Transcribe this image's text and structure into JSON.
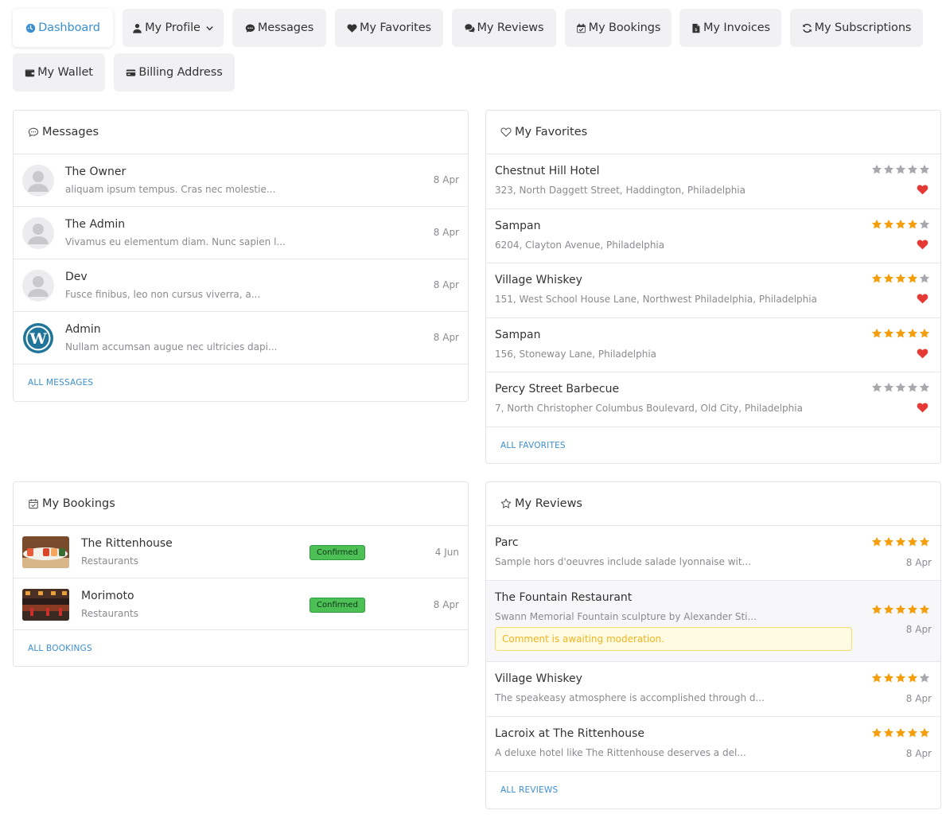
{
  "nav": {
    "dashboard": "Dashboard",
    "my_profile": "My Profile",
    "messages": "Messages",
    "my_favorites": "My Favorites",
    "my_reviews": "My Reviews",
    "my_bookings": "My Bookings",
    "my_invoices": "My Invoices",
    "my_subscriptions": "My Subscriptions",
    "my_wallet": "My Wallet",
    "billing_address": "Billing Address"
  },
  "messages": {
    "title": "Messages",
    "items": [
      {
        "name": "The Owner",
        "text": "aliquam ipsum tempus. Cras nec molestie...",
        "date": "8 Apr",
        "avatar": "default-avatar"
      },
      {
        "name": "The Admin",
        "text": "Vivamus eu elementum diam. Nunc sapien l...",
        "date": "8 Apr",
        "avatar": "default-avatar"
      },
      {
        "name": "Dev",
        "text": "Fusce finibus, leo non cursus viverra, a...",
        "date": "8 Apr",
        "avatar": "default-avatar"
      },
      {
        "name": "Admin",
        "text": "Nullam accumsan augue nec ultricies dapi...",
        "date": "8 Apr",
        "avatar": "wordpress-avatar"
      }
    ],
    "footer": "ALL MESSAGES"
  },
  "favorites": {
    "title": "My Favorites",
    "items": [
      {
        "name": "Chestnut Hill Hotel",
        "address": "323, North Daggett Street, Haddington, Philadelphia",
        "rating": 0
      },
      {
        "name": "Sampan",
        "address": "6204, Clayton Avenue, Philadelphia",
        "rating": 4
      },
      {
        "name": "Village Whiskey",
        "address": "151, West School House Lane, Northwest Philadelphia, Philadelphia",
        "rating": 4
      },
      {
        "name": "Sampan",
        "address": "156, Stoneway Lane, Philadelphia",
        "rating": 5
      },
      {
        "name": "Percy Street Barbecue",
        "address": "7, North Christopher Columbus Boulevard, Old City, Philadelphia",
        "rating": 0
      }
    ],
    "footer": "ALL FAVORITES"
  },
  "bookings": {
    "title": "My Bookings",
    "items": [
      {
        "name": "The Rittenhouse",
        "category": "Restaurants",
        "status": "Confirmed",
        "date": "4 Jun",
        "thumb": "sushi-photo"
      },
      {
        "name": "Morimoto",
        "category": "Restaurants",
        "status": "Confirmed",
        "date": "8 Apr",
        "thumb": "restaurant-interior-photo"
      }
    ],
    "footer": "ALL BOOKINGS"
  },
  "reviews": {
    "title": "My Reviews",
    "items": [
      {
        "name": "Parc",
        "text": "Sample hors d'oeuvres include salade lyonnaise wit...",
        "date": "8 Apr",
        "rating": 5
      },
      {
        "name": "The Fountain Restaurant",
        "text": "Swann Memorial Fountain sculpture by Alexander Sti...",
        "date": "8 Apr",
        "rating": 5,
        "notice": "Comment is awaiting moderation."
      },
      {
        "name": "Village Whiskey",
        "text": "The speakeasy atmosphere is accomplished through d...",
        "date": "8 Apr",
        "rating": 4
      },
      {
        "name": "Lacroix at The Rittenhouse",
        "text": "A deluxe hotel like The Rittenhouse deserves a del...",
        "date": "8 Apr",
        "rating": 5
      }
    ],
    "footer": "ALL REVIEWS"
  },
  "colors": {
    "accent": "#3b8fd0",
    "star_on": "#f59e0b",
    "star_off": "#a8a8ad",
    "heart": "#e53935",
    "badge": "#4cbf55"
  }
}
